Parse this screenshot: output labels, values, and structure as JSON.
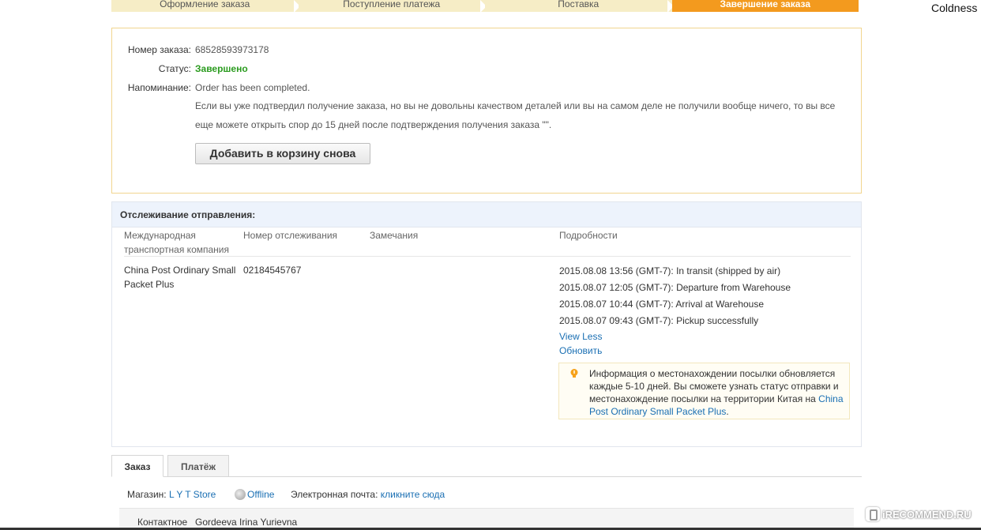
{
  "steps": [
    {
      "label": "Оформление заказа",
      "active": false
    },
    {
      "label": "Поступление платежа",
      "active": false
    },
    {
      "label": "Поставка",
      "active": false
    },
    {
      "label": "Завершение заказа",
      "active": true
    }
  ],
  "user_name": "Coldness",
  "order": {
    "number_label": "Номер заказа:",
    "number_value": "68528593973178",
    "status_label": "Статус:",
    "status_value": "Завершено",
    "reminder_label": "Напоминание:",
    "reminder_value": "Order has been completed.",
    "dispute_note": "Если вы уже подтвердил получение заказа, но вы не довольны качеством деталей или вы на самом деле не получили вообще ничего, то вы все еще можете открыть спор до 15 дней после подтверждения получения заказа \"\".",
    "add_to_cart_label": "Добавить в корзину снова"
  },
  "tracking": {
    "title": "Отслеживание отправления:",
    "headers": {
      "carrier": "Международная транспортная компания",
      "tracking_number": "Номер отслеживания",
      "remarks": "Замечания",
      "details": "Подробности"
    },
    "carrier": "China Post Ordinary Small Packet Plus",
    "tracking_number": "02184545767",
    "events": [
      "2015.08.08 13:56 (GMT-7): In transit (shipped by air)",
      "2015.08.07 12:05 (GMT-7): Departure from Warehouse",
      "2015.08.07 10:44 (GMT-7): Arrival at Warehouse",
      "2015.08.07 09:43 (GMT-7): Pickup successfully"
    ],
    "view_less": "View Less",
    "refresh": "Обновить",
    "info_text": "Информация о местонахождении посылки обновляется каждые 5-10 дней. Вы сможете узнать статус отправки и местонахождение посылки на территории Китая на",
    "info_link": "China Post Ordinary Small Packet Plus",
    "info_end": "."
  },
  "tabs": [
    {
      "label": "Заказ",
      "active": true
    },
    {
      "label": "Платёж",
      "active": false
    }
  ],
  "store": {
    "store_label": "Магазин:",
    "store_name": "L Y T Store",
    "offline": "Offline",
    "email_label": "Электронная почта:",
    "email_link": "кликните сюда"
  },
  "contact": {
    "label": "Контактное",
    "value": "Gordeeva Irina Yurievna"
  },
  "watermark": "iRECOMMEND.RU"
}
